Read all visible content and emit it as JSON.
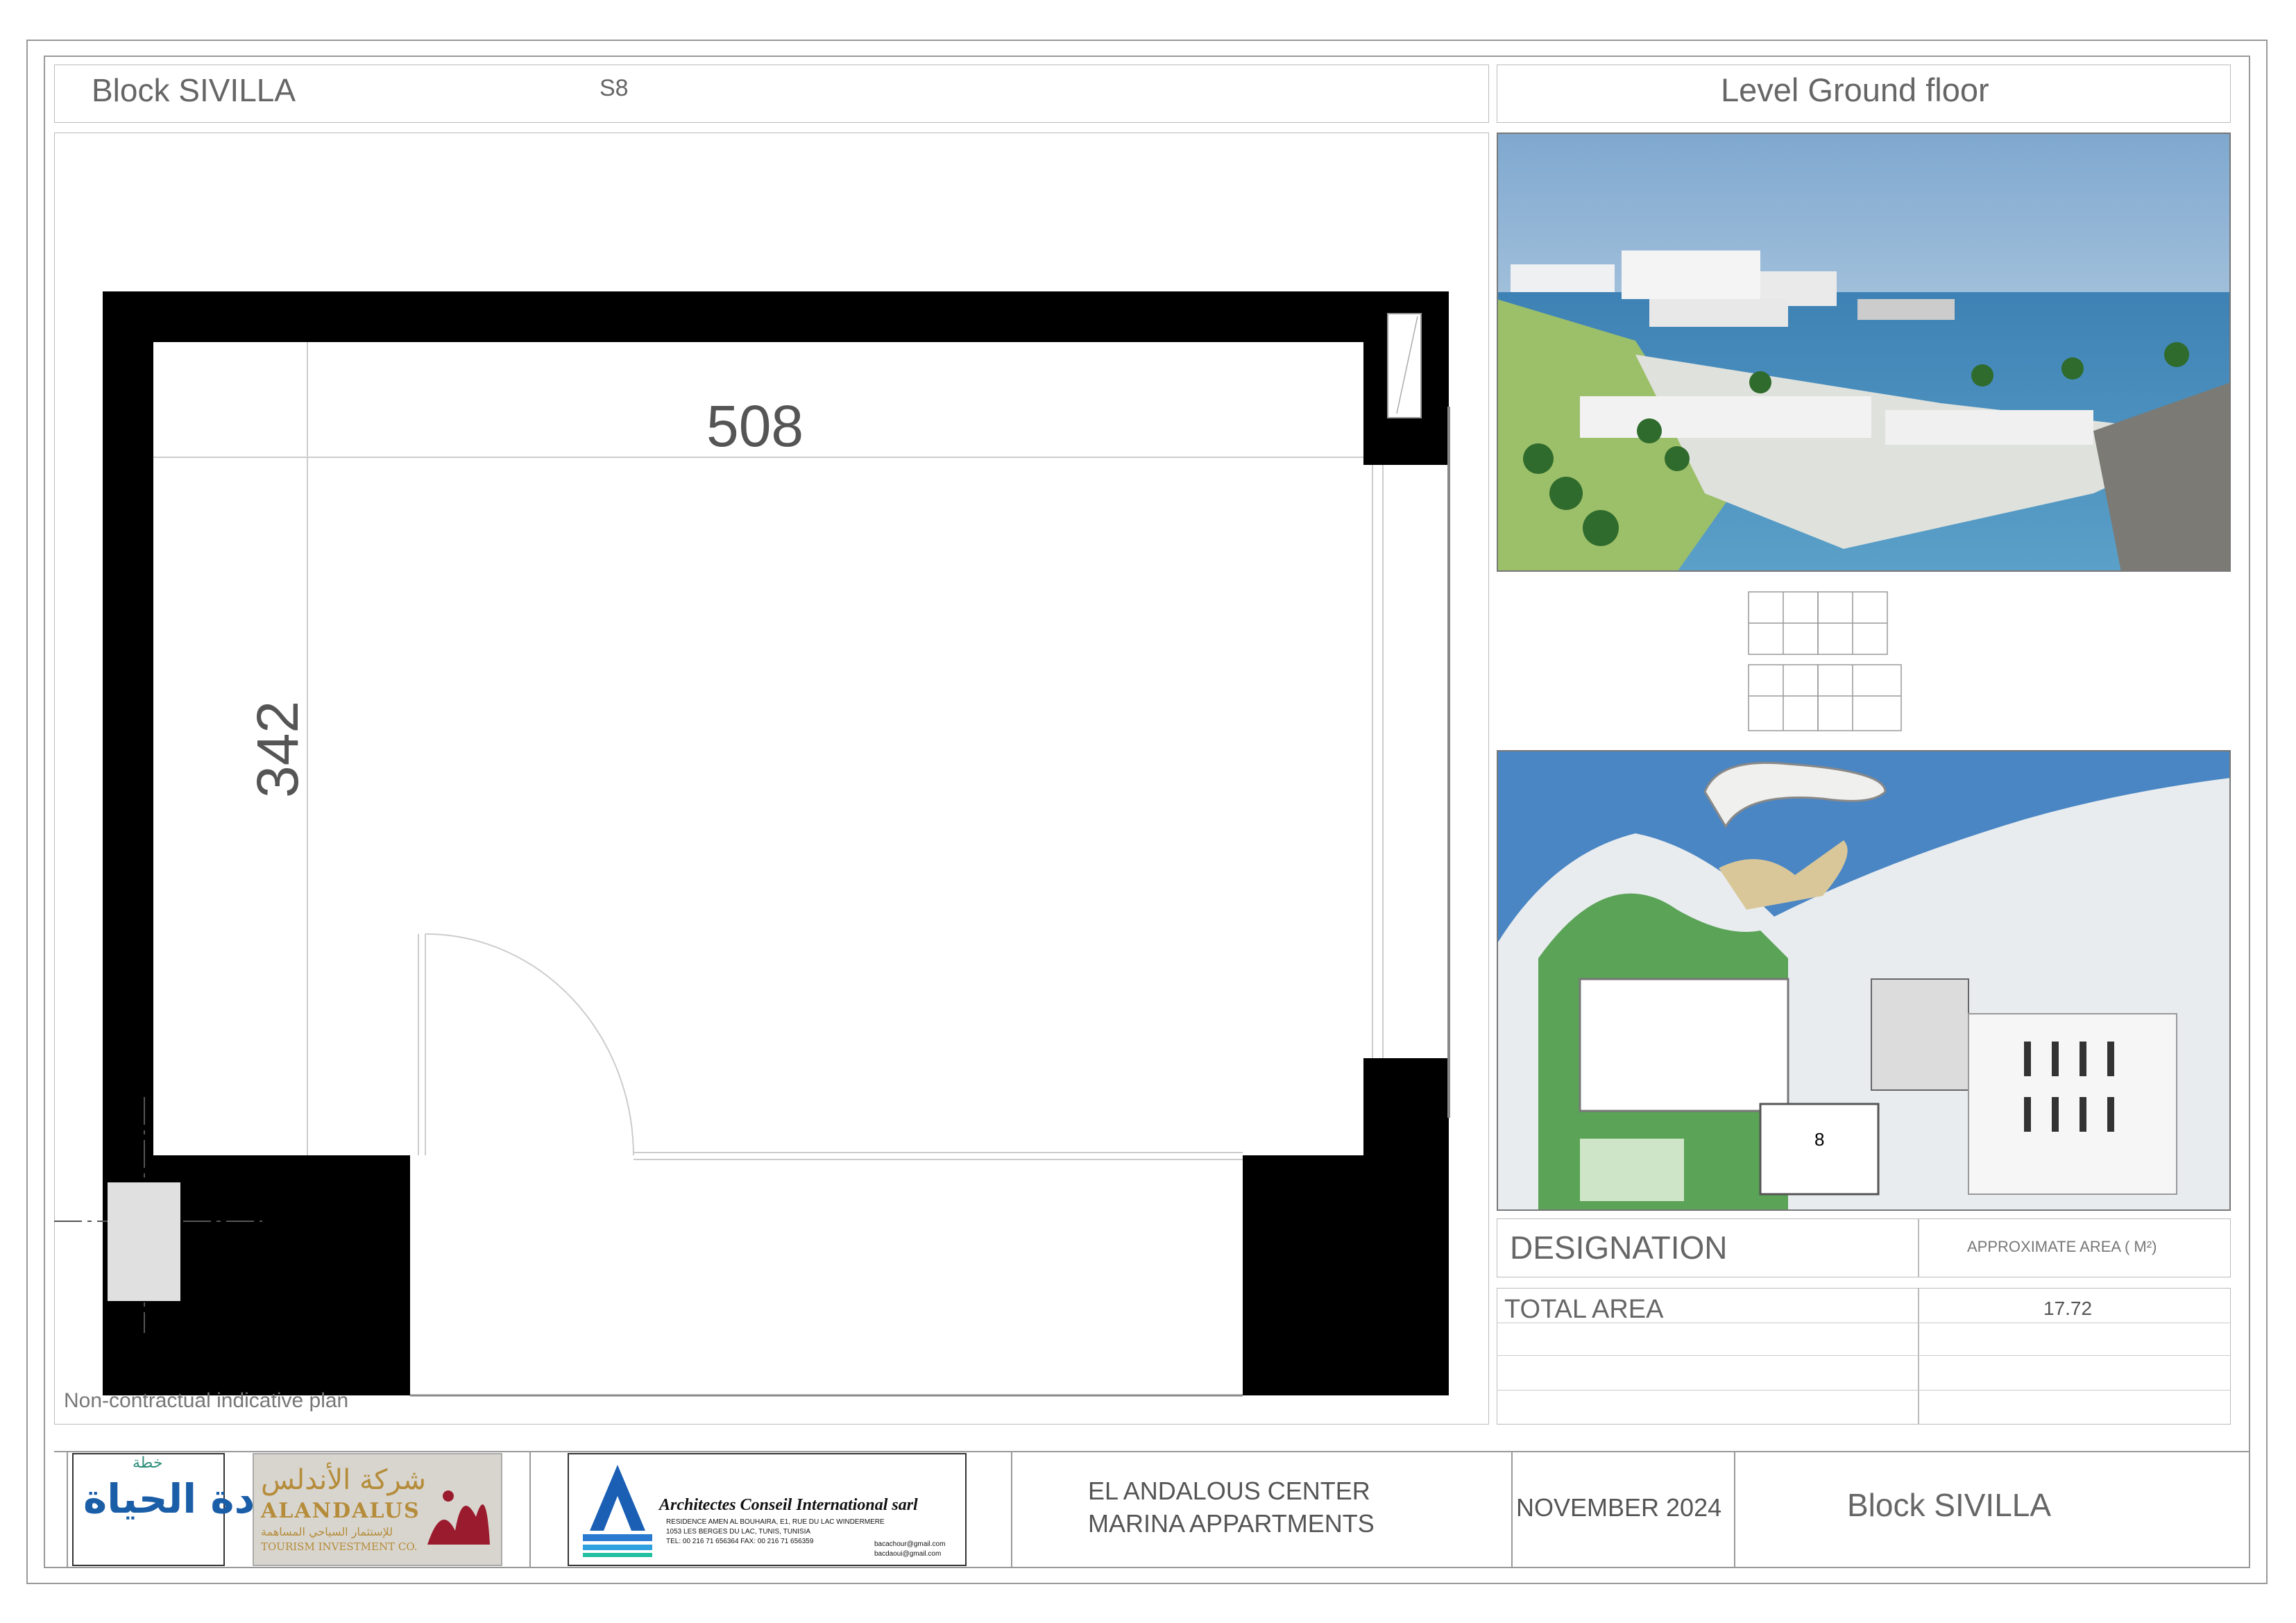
{
  "header": {
    "block_label": "Block SIVILLA",
    "unit_code": "S8",
    "level_label": "Level Ground floor"
  },
  "plan": {
    "dim_width": "508",
    "dim_height": "342",
    "note": "Non-contractual indicative plan"
  },
  "area_table": {
    "designation_header": "DESIGNATION",
    "area_header": "APPROXIMATE AREA  ( M²)",
    "rows": [
      {
        "label": "TOTAL AREA",
        "value": "17.72"
      }
    ]
  },
  "site_plan": {
    "block_marker": "8"
  },
  "footer": {
    "project_line1": "EL ANDALOUS CENTER",
    "project_line2": "MARINA APPARTMENTS",
    "date": "NOVEMBER 2024",
    "block": "Block  SIVILLA",
    "logo1_text": "عودة الحياة",
    "logo1_small": "خطة",
    "logo2_arabic": "شركة الأندلس",
    "logo2_name": "ALANDALUS",
    "logo2_sub_ar": "للإستثمار السياحي المساهمة",
    "logo2_sub": "TOURISM INVESTMENT CO.",
    "logo3_name": "Architectes  Conseil  International sarl",
    "logo3_addr1": "RESIDENCE  AMEN AL BOUHAIRA, E1, RUE DU LAC WINDERMERE",
    "logo3_addr2": "1053 LES BERGES DU LAC, TUNIS, TUNISIA",
    "logo3_tel": "TEL: 00 216 71 656364   FAX: 00 216 71 656359",
    "logo3_mail1": "bacachour@gmail.com",
    "logo3_mail2": "bacdaoui@gmail.com"
  }
}
